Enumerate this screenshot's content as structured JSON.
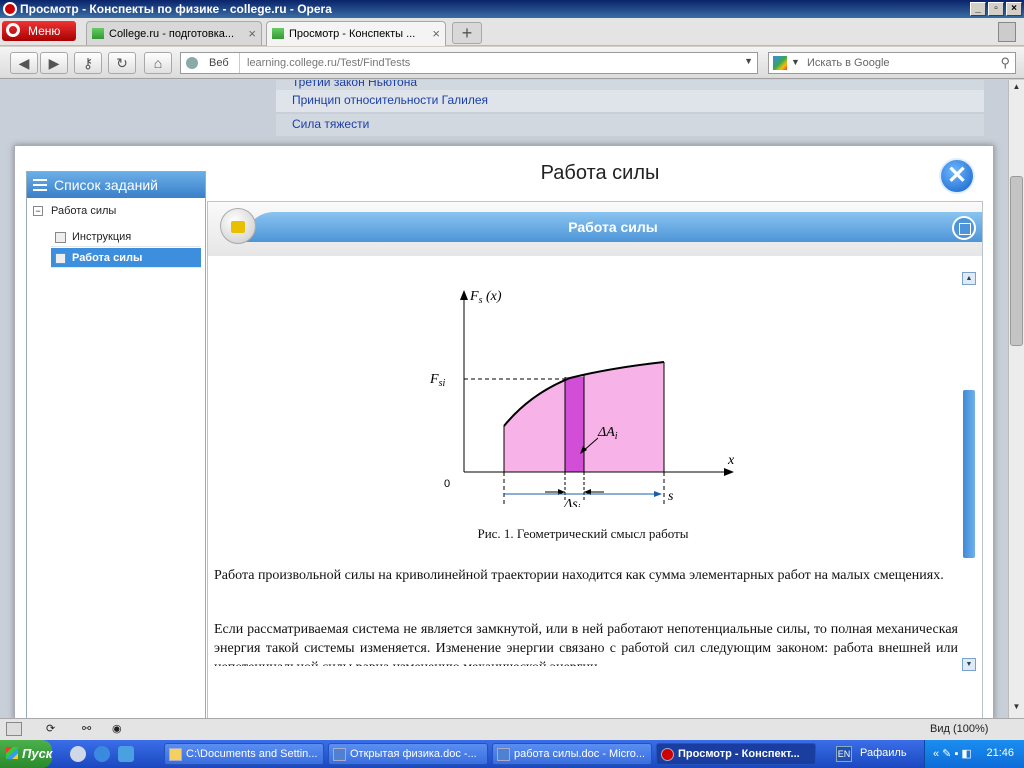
{
  "window": {
    "title": "Просмотр - Конспекты по физике - college.ru - Opera"
  },
  "browser": {
    "menu_label": "Меню",
    "tabs": [
      {
        "label": "College.ru - подготовка...",
        "active": false
      },
      {
        "label": "Просмотр - Конспекты ...",
        "active": true
      }
    ],
    "address": {
      "scope_label": "Веб",
      "url": "learning.college.ru/Test/FindTests"
    },
    "search": {
      "placeholder": "Искать в Google"
    }
  },
  "page_background": {
    "links": [
      "Третий закон Ньютона",
      "Принцип относительности Галилея",
      "Сила тяжести"
    ]
  },
  "modal": {
    "title": "Работа силы",
    "sidebar": {
      "header": "Список заданий",
      "root": "Работа силы",
      "items": [
        {
          "label": "Инструкция",
          "selected": false
        },
        {
          "label": "Работа силы",
          "selected": true
        }
      ]
    },
    "content": {
      "header": "Работа силы",
      "figure": {
        "y_axis": "F",
        "y_axis_sub": "s",
        "y_axis_arg": " (x)",
        "f_label": "F",
        "f_label_sub": "si",
        "x_axis": "x",
        "origin": "0",
        "delta_a": "ΔA",
        "delta_a_sub": "i",
        "delta_s": "Δs",
        "delta_s_sub": "i",
        "s_label": "s"
      },
      "caption": "Рис. 1. Геометрический смысл работы",
      "paragraphs": [
        "Работа произвольной силы на криволинейной траектории находится как сумма элементарных работ на малых смещениях.",
        "Если рассматриваемая система не является замкнутой, или в ней работают непотенциальные силы, то полная механическая энергия такой системы изменяется. Изменение энергии связано с работой сил следующим законом: работа внешней или непотенциальной силы равна изменению механической энергии"
      ]
    }
  },
  "statusbar": {
    "zoom": "Вид (100%)"
  },
  "taskbar": {
    "start": "Пуск",
    "buttons": [
      {
        "label": "C:\\Documents and Settin...",
        "active": false
      },
      {
        "label": "Открытая физика.doc -...",
        "active": false
      },
      {
        "label": "работа силы.doc - Micro...",
        "active": false
      },
      {
        "label": "Просмотр - Конспект...",
        "active": true
      }
    ],
    "lang": "EN",
    "user": "Рафаиль",
    "clock": "21:46"
  },
  "colors": {
    "accent": "#4d95d8",
    "fill_area": "#f7b2e8",
    "fill_strip": "#d34ed6"
  }
}
